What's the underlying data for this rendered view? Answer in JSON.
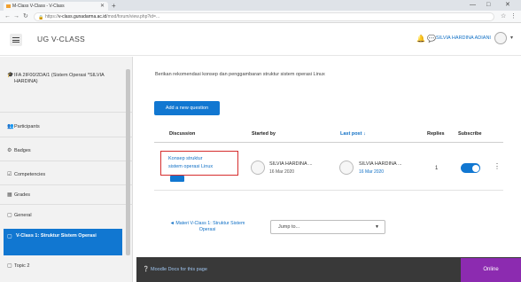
{
  "browser": {
    "tab_title": "M-Class V-Class - V-Class",
    "new_tab": "+",
    "window_controls": [
      "—",
      "□",
      "✕"
    ],
    "url_prefix": "https://",
    "url_domain": "v-class.gunadarma.ac.id",
    "url_path": "/mod/forum/view.php?id=..."
  },
  "navbar": {
    "site_name": "UG V-CLASS",
    "user_name": "SILVIA HARDINA ADIANI",
    "bell": "🔔",
    "chat": "💬"
  },
  "drawer": {
    "course": "IFA 2IF00/2DA/1 (Sistem Operasi *SILVIA HARDINA)",
    "items": [
      {
        "icon": "participants-icon",
        "glyph": "👥",
        "label": "Participants"
      },
      {
        "icon": "badges-icon",
        "glyph": "⚙",
        "label": "Badges"
      },
      {
        "icon": "competencies-icon",
        "glyph": "☑",
        "label": "Competencies"
      },
      {
        "icon": "grades-icon",
        "glyph": "▦",
        "label": "Grades"
      },
      {
        "icon": "general-icon",
        "glyph": "▢",
        "label": "General"
      }
    ],
    "active": "V-Class 1: Struktur Sistem Operasi",
    "next": "Topic 2"
  },
  "main": {
    "intro": "Berikan rekomendasi konsep dan penggambaran struktur sistem operasi Linux",
    "add_button": "Add a new question",
    "columns": {
      "discussion": "Discussion",
      "started_by": "Started by",
      "last_post": "Last post ↓",
      "replies": "Replies",
      "subscribe": "Subscribe"
    },
    "row": {
      "title_line1": "Konsep struktur",
      "title_line2": "sistem operasi Linux",
      "started_name": "SILVIA HARDINA ...",
      "started_date": "16 Mar 2020",
      "last_name": "SILVIA HARDINA ...",
      "last_date": "16 Mar 2020",
      "replies": "1",
      "subscribed": true
    },
    "prev_link": "◄ Materi V-Class 1: Struktur Sistem Operasi",
    "jump_to": "Jump to..."
  },
  "footer": {
    "docs_link": "Moodle Docs for this page",
    "online": "Online"
  }
}
